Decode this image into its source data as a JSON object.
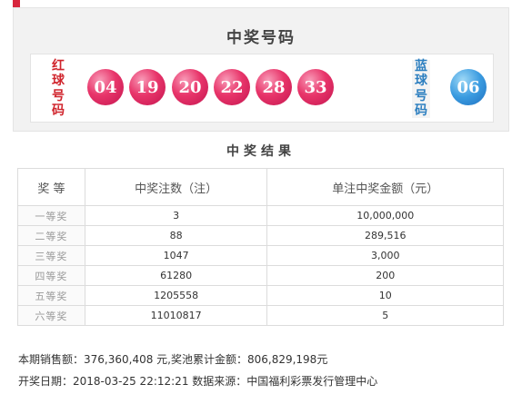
{
  "draw": {
    "title": "中奖号码",
    "red_label": [
      "红",
      "球",
      "号",
      "码"
    ],
    "blue_label": [
      "蓝",
      "球",
      "号",
      "码"
    ],
    "red_balls": [
      "04",
      "19",
      "20",
      "22",
      "28",
      "33"
    ],
    "blue_ball": "06"
  },
  "results": {
    "title": "中奖结果",
    "headers": {
      "level": "奖 等",
      "winners": "中奖注数（注）",
      "amount": "单注中奖金额（元）"
    },
    "rows": [
      {
        "level": "一等奖",
        "winners": "3",
        "amount": "10,000,000"
      },
      {
        "level": "二等奖",
        "winners": "88",
        "amount": "289,516"
      },
      {
        "level": "三等奖",
        "winners": "1047",
        "amount": "3,000"
      },
      {
        "level": "四等奖",
        "winners": "61280",
        "amount": "200"
      },
      {
        "level": "五等奖",
        "winners": "1205558",
        "amount": "10"
      },
      {
        "level": "六等奖",
        "winners": "11010817",
        "amount": "5"
      }
    ]
  },
  "footer": {
    "sales_line": "本期销售额：376,360,408 元,奖池累计金额：806,829,198元",
    "date_line": "开奖日期：2018-03-25 22:12:21 数据来源：中国福利彩票发行管理中心"
  },
  "colors": {
    "red_ball": "#e8356a",
    "blue_ball": "#3a9be0",
    "red_label": "#d0252d",
    "blue_label": "#2d7fc0",
    "corner_accent": "#d7263d"
  }
}
